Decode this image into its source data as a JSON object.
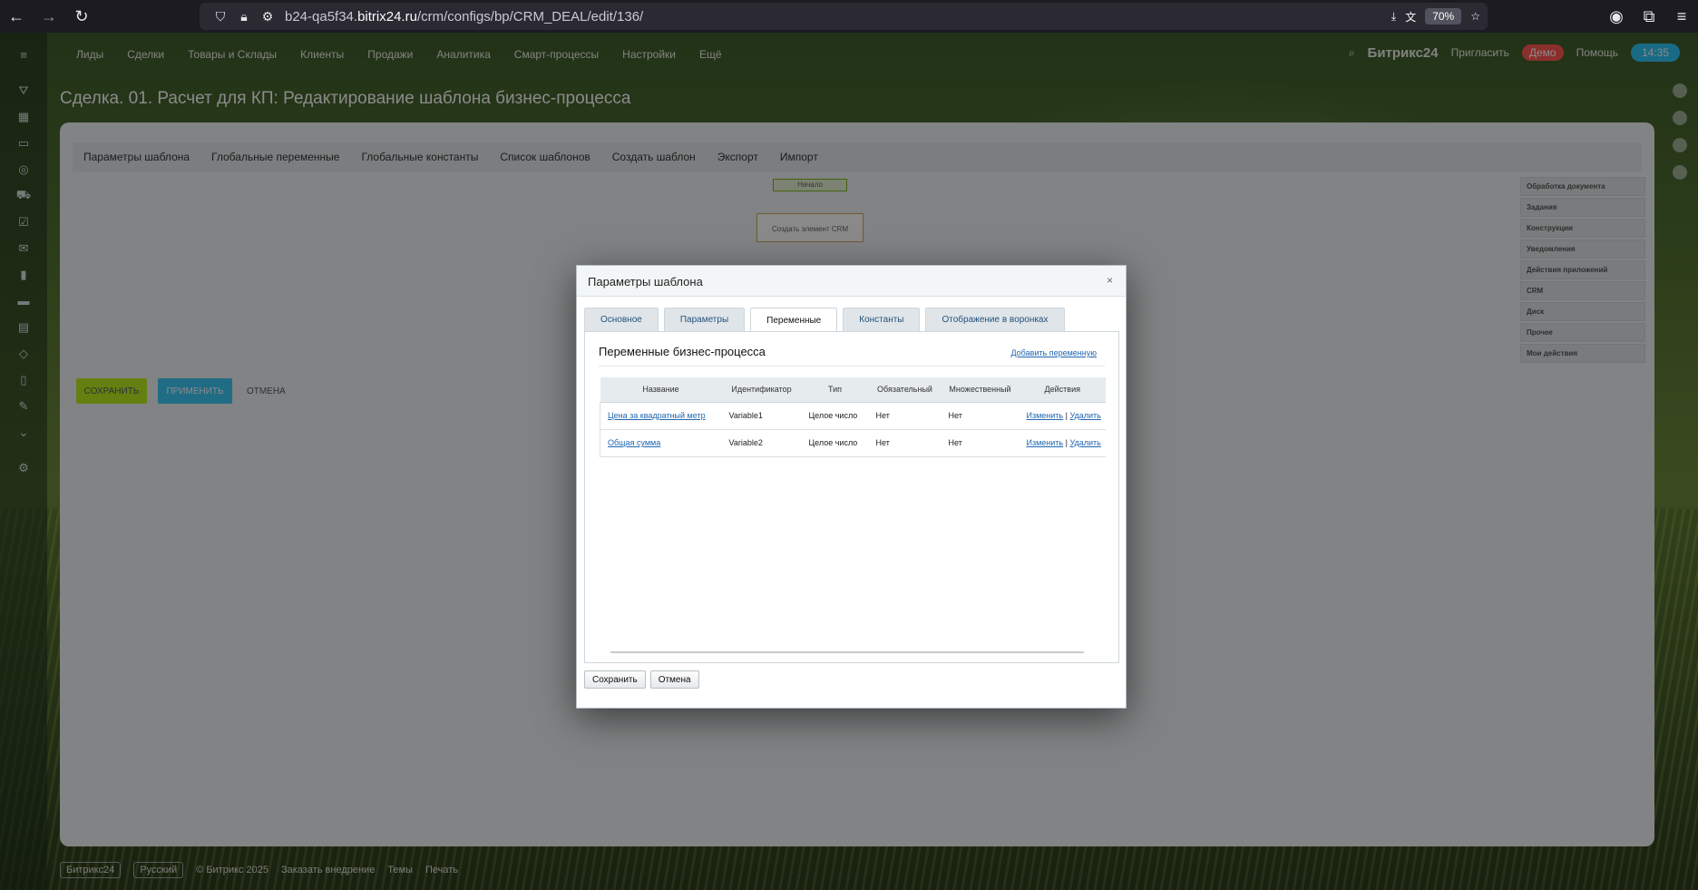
{
  "browser": {
    "url_prefix": "b24-qa5f34.",
    "url_domain": "bitrix24.ru",
    "url_path": "/crm/configs/bp/CRM_DEAL/edit/136/",
    "zoom": "70%"
  },
  "bitrix": {
    "top_nav": [
      "Лиды",
      "Сделки",
      "Товары и Склады",
      "Клиенты",
      "Продажи",
      "Аналитика",
      "Смарт-процессы",
      "Настройки",
      "Ещё"
    ],
    "logo": "Битрикс24",
    "invite": "Пригласить",
    "demo": "Демо",
    "help": "Помощь",
    "time": "14:35",
    "page_title": "Сделка. 01. Расчет для КП: Редактирование шаблона бизнес-процесса",
    "toolbar": [
      "Параметры шаблона",
      "Глобальные переменные",
      "Глобальные константы",
      "Список шаблонов",
      "Создать шаблон",
      "Экспорт",
      "Импорт"
    ],
    "flow_start": "Начало",
    "flow_activity": "Создать элемент CRM",
    "save": "СОХРАНИТЬ",
    "apply": "ПРИМЕНИТЬ",
    "cancel": "ОТМЕНА",
    "activity_groups": [
      "Обработка документа",
      "Задания",
      "Конструкции",
      "Уведомления",
      "Действия приложений",
      "CRM",
      "Диск",
      "Прочее",
      "Мои действия"
    ],
    "footer": [
      "Битрикс24",
      "Русский",
      "© Битрикс 2025",
      "Заказать внедрение",
      "Темы",
      "Печать"
    ]
  },
  "dialog": {
    "title": "Параметры шаблона",
    "close": "×",
    "tabs": [
      "Основное",
      "Параметры",
      "Переменные",
      "Константы",
      "Отображение в воронках"
    ],
    "active_tab": "Переменные",
    "section_title": "Переменные бизнес-процесса",
    "add_variable": "Добавить переменную",
    "columns": [
      "Название",
      "Идентификатор",
      "Тип",
      "Обязательный",
      "Множественный",
      "Действия"
    ],
    "rows": [
      {
        "name": "Цена за квадратный метр",
        "id": "Variable1",
        "type": "Целое число",
        "required": "Нет",
        "multiple": "Нет",
        "edit": "Изменить",
        "sep": "|",
        "delete": "Удалить"
      },
      {
        "name": "Общая сумма",
        "id": "Variable2",
        "type": "Целое число",
        "required": "Нет",
        "multiple": "Нет",
        "edit": "Изменить",
        "sep": "|",
        "delete": "Удалить"
      }
    ],
    "save_button": "Сохранить",
    "cancel_button": "Отмена"
  }
}
